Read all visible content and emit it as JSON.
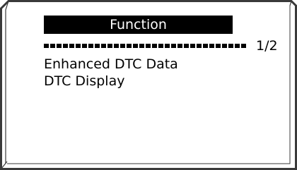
{
  "screen": {
    "title": "Function",
    "page_indicator": "1/2",
    "menu_items": [
      {
        "label": "Enhanced DTC Data"
      },
      {
        "label": "DTC Display"
      }
    ]
  },
  "colors": {
    "background": "#ffffff",
    "title_bar_bg": "#000000",
    "title_bar_text": "#ffffff",
    "text": "#000000",
    "bezel_stroke": "#3a3a3a"
  }
}
